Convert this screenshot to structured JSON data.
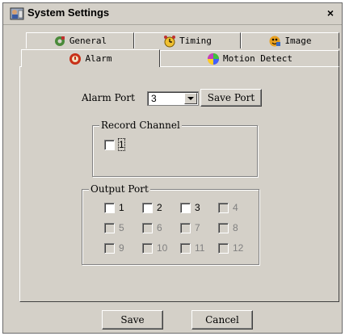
{
  "window": {
    "title": "System Settings",
    "close_glyph": "×"
  },
  "tabs": {
    "row1": [
      {
        "label": "General",
        "icon": "general-icon"
      },
      {
        "label": "Timing",
        "icon": "timing-icon"
      },
      {
        "label": "Image",
        "icon": "image-icon"
      }
    ],
    "row2": [
      {
        "label": "Alarm",
        "icon": "alarm-icon",
        "active": true
      },
      {
        "label": "Motion Detect",
        "icon": "motion-detect-icon"
      }
    ]
  },
  "alarm": {
    "port_label": "Alarm Port",
    "port_value": "3",
    "save_port_label": "Save Port",
    "record_channel": {
      "title": "Record Channel",
      "channels": [
        {
          "label": "1",
          "checked": false,
          "enabled": true
        }
      ]
    },
    "output_port": {
      "title": "Output Port",
      "ports": [
        {
          "label": "1",
          "enabled": true
        },
        {
          "label": "2",
          "enabled": true
        },
        {
          "label": "3",
          "enabled": true
        },
        {
          "label": "4",
          "enabled": false
        },
        {
          "label": "5",
          "enabled": false
        },
        {
          "label": "6",
          "enabled": false
        },
        {
          "label": "7",
          "enabled": false
        },
        {
          "label": "8",
          "enabled": false
        },
        {
          "label": "9",
          "enabled": false
        },
        {
          "label": "10",
          "enabled": false
        },
        {
          "label": "11",
          "enabled": false
        },
        {
          "label": "12",
          "enabled": false
        }
      ]
    }
  },
  "footer": {
    "save_label": "Save",
    "cancel_label": "Cancel"
  }
}
